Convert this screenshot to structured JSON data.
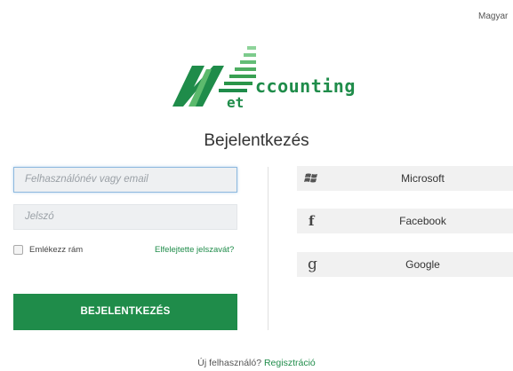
{
  "header": {
    "language": "Magyar"
  },
  "logo": {
    "word": "ccounting",
    "suffix": "et"
  },
  "login": {
    "title": "Bejelentkezés",
    "username_placeholder": "Felhasználónév vagy email",
    "password_placeholder": "Jelszó",
    "remember_label": "Emlékezz rám",
    "forgot_label": "Elfelejtette jelszavát?",
    "submit_label": "BEJELENTKEZÉS"
  },
  "social": [
    {
      "label": "Microsoft",
      "icon": "windows-icon"
    },
    {
      "label": "Facebook",
      "icon": "facebook-icon"
    },
    {
      "label": "Google",
      "icon": "google-icon"
    }
  ],
  "footer": {
    "text": "Új felhasználó?",
    "link": "Regisztráció"
  },
  "colors": {
    "brand": "#1f8c4a",
    "brand_light": "#8ed49a",
    "input_bg": "#eef0f2",
    "social_bg": "#f1f1f1"
  }
}
